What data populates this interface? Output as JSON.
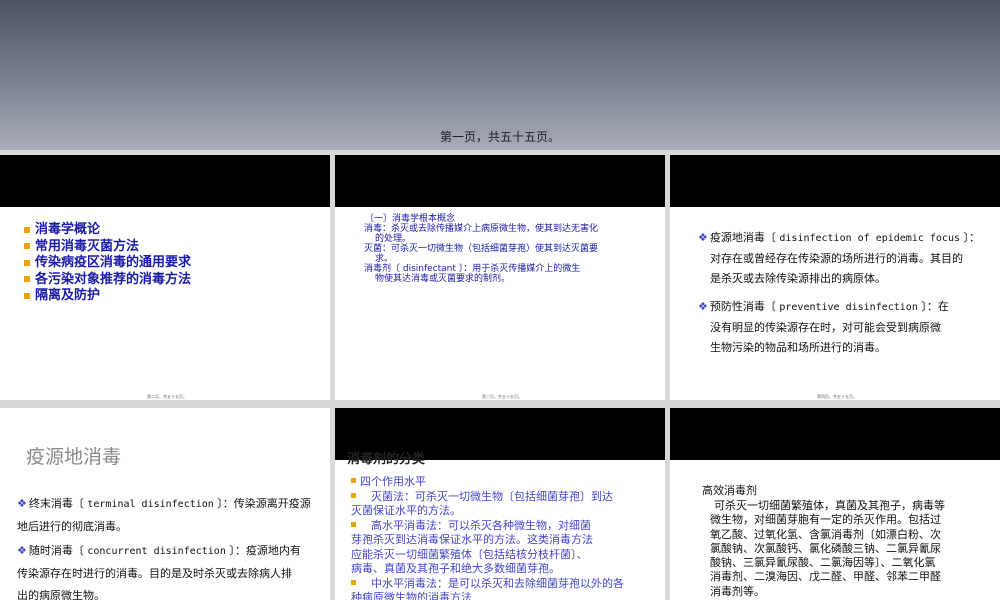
{
  "top": {
    "footer": "第一页，共五十五页。"
  },
  "slide2": {
    "items": [
      "消毒学概论",
      "常用消毒灭菌方法",
      "传染病疫区消毒的通用要求",
      "各污染对象推荐的消毒方法",
      "隔离及防护"
    ],
    "footer": "第二页，共五十五页。"
  },
  "slide3": {
    "heading": "〔一〕消毒学根本概念",
    "l1": "消毒：杀灭或去除传播媒介上病原微生物，使其到达无害化",
    "l1b": "的处理。",
    "l2": "灭菌：可杀灭一切微生物（包括细菌芽孢）使其到达灭菌要",
    "l2b": "求。",
    "l3": "消毒剂〔 disinfectant 〕：用于杀灭传播媒介上的微生",
    "l3b": "物使其达消毒或灭菌要求的制剂。",
    "footer": "第三页，共五十五页。"
  },
  "slide4": {
    "p1_label": "疫源地消毒〔 ",
    "p1_en": "disinfection of epidemic focus",
    "p1_end": " 〕：",
    "p1_l2": "对存在或曾经存在传染源的场所进行的消毒。其目的",
    "p1_l3": "是杀灭或去除传染源排出的病原体。",
    "p2_label": "预防性消毒〔 ",
    "p2_en": "preventive disinfection",
    "p2_end": " 〕：在",
    "p2_l2": "没有明显的传染源存在时，对可能会受到病原微",
    "p2_l3": "生物污染的物品和场所进行的消毒。",
    "footer": "第四页，共五十五页。"
  },
  "slide5": {
    "title": "疫源地消毒",
    "p1_label": "终末消毒〔 ",
    "p1_en": "terminal disinfection",
    "p1_end": " 〕：传染源离开疫源",
    "p1_l2": "地后进行的彻底消毒。",
    "p2_label": "随时消毒〔 ",
    "p2_en": "concurrent disinfection",
    "p2_end": " 〕：疫源地内有",
    "p2_l2": "传染源存在时进行的消毒。目的是及时杀灭或去除病人排",
    "p2_l3": "出的病原微生物。"
  },
  "slide6": {
    "bar_text": "消毒剂的分类",
    "i1": "四个作用水平",
    "i2a": "　灭菌法：可杀灭一切微生物〔包括细菌芽孢〕到达",
    "i2b": "灭菌保证水平的方法。",
    "i3a": "　高水平消毒法：可以杀灭各种微生物，对细菌",
    "i3b": "芽孢杀灭到达消毒保证水平的方法。这类消毒方法",
    "i3c": "应能杀灭一切细菌繁殖体〔包括结核分枝杆菌〕、",
    "i3d": "病毒、真菌及其孢子和绝大多数细菌芽孢。",
    "i4a": "　中水平消毒法：是可以杀灭和去除细菌芽孢以外的各",
    "i4b": "种病原微生物的消毒方法"
  },
  "slide7": {
    "title": "高效消毒剂",
    "l1": "可杀灭一切细菌繁殖体，真菌及其孢子，病毒等",
    "l2": "微生物，对细菌芽胞有一定的杀灭作用。包括过",
    "l3": "氧乙酸、过氧化氢、含氯消毒剂〔如漂白粉、次",
    "l4": "氯酸钠、次氯酸钙、氯化磷酸三钠、二氯异氰尿",
    "l5": "酸钠、三氯异氰尿酸、二氯海因等〕、二氧化氯",
    "l6": "消毒剂、二溴海因、戊二醛、甲醛、邻苯二甲醛",
    "l7": "消毒剂等。"
  }
}
